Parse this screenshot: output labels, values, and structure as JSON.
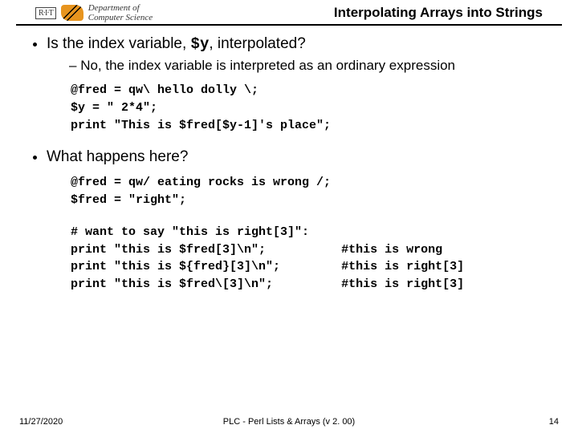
{
  "header": {
    "logo_dept": "Department of",
    "logo_cs": "Computer Science",
    "logo_rit": "R·I·T",
    "title": "Interpolating Arrays into Strings"
  },
  "bullets": {
    "q1_pre": "Is the index variable, ",
    "q1_code": "$y",
    "q1_post": ", interpolated?",
    "q1_sub": "No, the index variable is interpreted as an ordinary expression",
    "q2": "What happens here?"
  },
  "code1": "@fred = qw\\ hello dolly \\;\n$y = \" 2*4\";\nprint \"This is $fred[$y-1]'s place\";",
  "code2": "@fred = qw/ eating rocks is wrong /;\n$fred = \"right\";",
  "code3_left": "# want to say \"this is right[3]\":\nprint \"this is $fred[3]\\n\";\nprint \"this is ${fred}[3]\\n\";\nprint \"this is $fred\\[3]\\n\";",
  "code3_right": "\n#this is wrong\n#this is right[3]\n#this is right[3]",
  "footer": {
    "date": "11/27/2020",
    "center": "PLC - Perl Lists & Arrays (v 2. 00)",
    "page": "14"
  }
}
